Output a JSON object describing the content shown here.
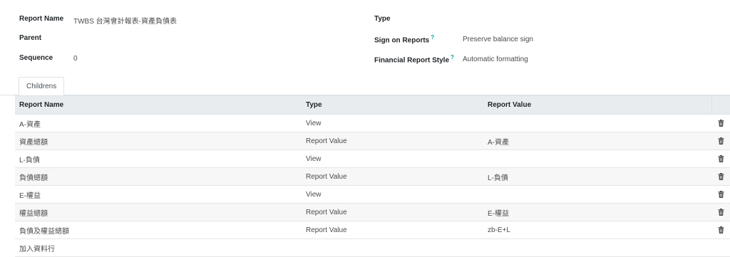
{
  "form": {
    "report_name_label": "Report Name",
    "report_name_value": "TWBS 台灣會計報表-資產負債表",
    "parent_label": "Parent",
    "parent_value": "",
    "sequence_label": "Sequence",
    "sequence_value": "0",
    "type_label": "Type",
    "type_value": "",
    "sign_label": "Sign on Reports",
    "sign_help": "?",
    "sign_value": "Preserve balance sign",
    "style_label": "Financial Report Style",
    "style_help": "?",
    "style_value": "Automatic formatting"
  },
  "tabs": [
    {
      "label": "Childrens",
      "active": true
    }
  ],
  "table": {
    "columns": [
      "Report Name",
      "Type",
      "Report Value"
    ],
    "rows": [
      {
        "name": "A-資產",
        "type": "View",
        "value": ""
      },
      {
        "name": "資產總額",
        "type": "Report Value",
        "value": "A-資產"
      },
      {
        "name": "L-負債",
        "type": "View",
        "value": ""
      },
      {
        "name": "負債總額",
        "type": "Report Value",
        "value": "L-負債"
      },
      {
        "name": "E-權益",
        "type": "View",
        "value": ""
      },
      {
        "name": "權益總額",
        "type": "Report Value",
        "value": "E-權益"
      },
      {
        "name": "負債及權益總額",
        "type": "Report Value",
        "value": "zb-E+L"
      }
    ],
    "add_line": "加入資料行",
    "delete_icon": "trash-icon"
  },
  "colors": {
    "accent": "#00a09d",
    "link": "#7c7bad"
  }
}
